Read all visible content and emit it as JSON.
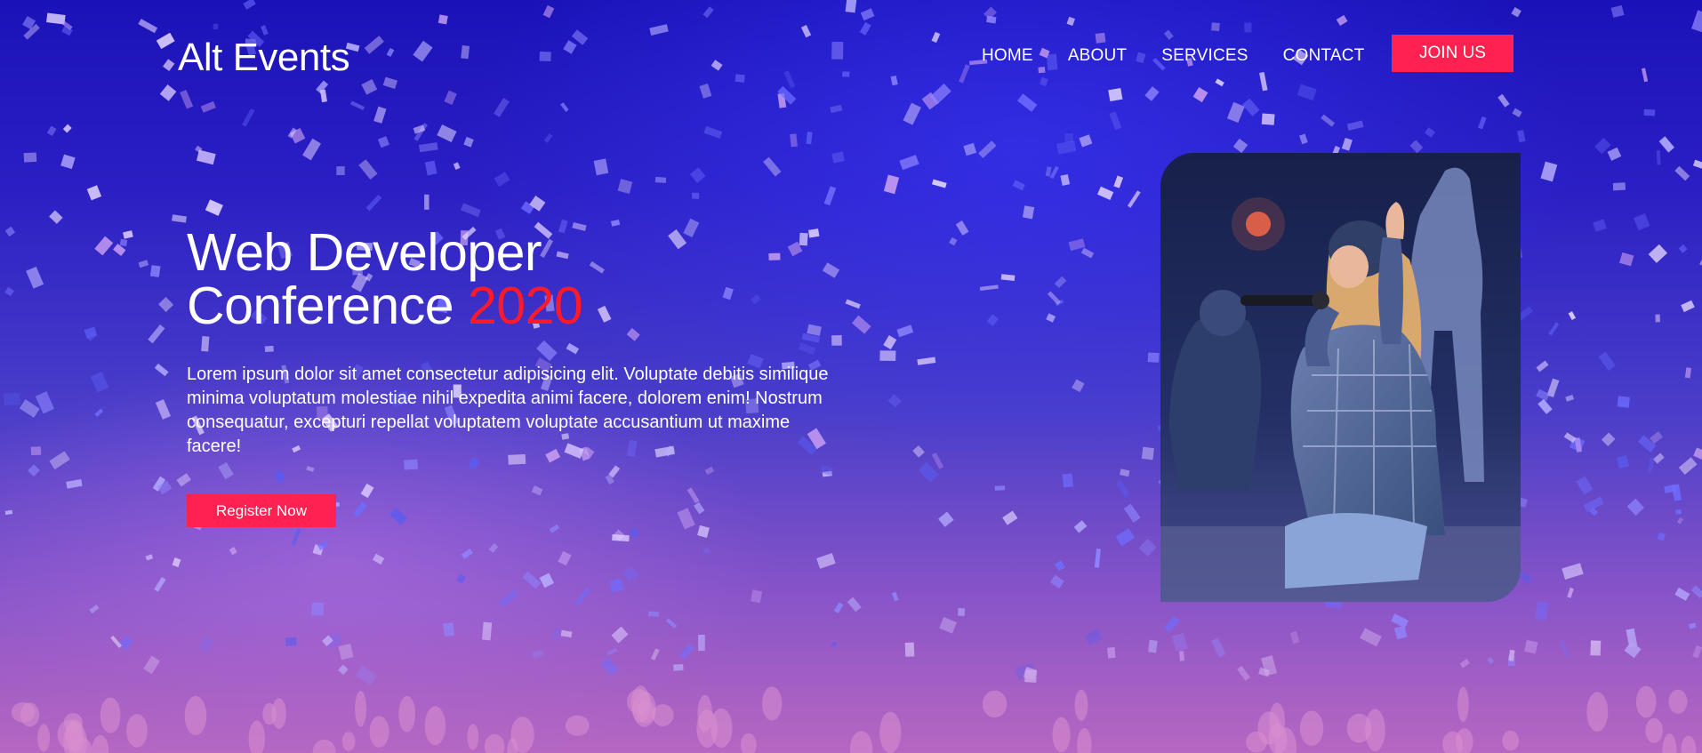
{
  "header": {
    "logo": "Alt Events",
    "nav": [
      {
        "label": "HOME"
      },
      {
        "label": "ABOUT"
      },
      {
        "label": "SERVICES"
      },
      {
        "label": "CONTACT"
      }
    ],
    "cta": "JOIN US"
  },
  "hero": {
    "title_line1": "Web Developer",
    "title_line2": "Conference",
    "title_year": "2020",
    "description": "Lorem ipsum dolor sit amet consectetur adipisicing elit. Voluptate debitis similique minima voluptatum molestiae nihil expedita animi facere, dolorem enim! Nostrum consequatur, excepturi repellat voluptatem voluptate accusantium ut maxime facere!",
    "register_label": "Register Now"
  },
  "colors": {
    "accent": "#ff2150",
    "year": "#ff1a2a",
    "background_top": "#1a12b8",
    "background_bottom": "#a964c4"
  },
  "images": {
    "hero_background": "confetti-concert-crowd",
    "side_photo": "singer-performing-on-stage"
  }
}
